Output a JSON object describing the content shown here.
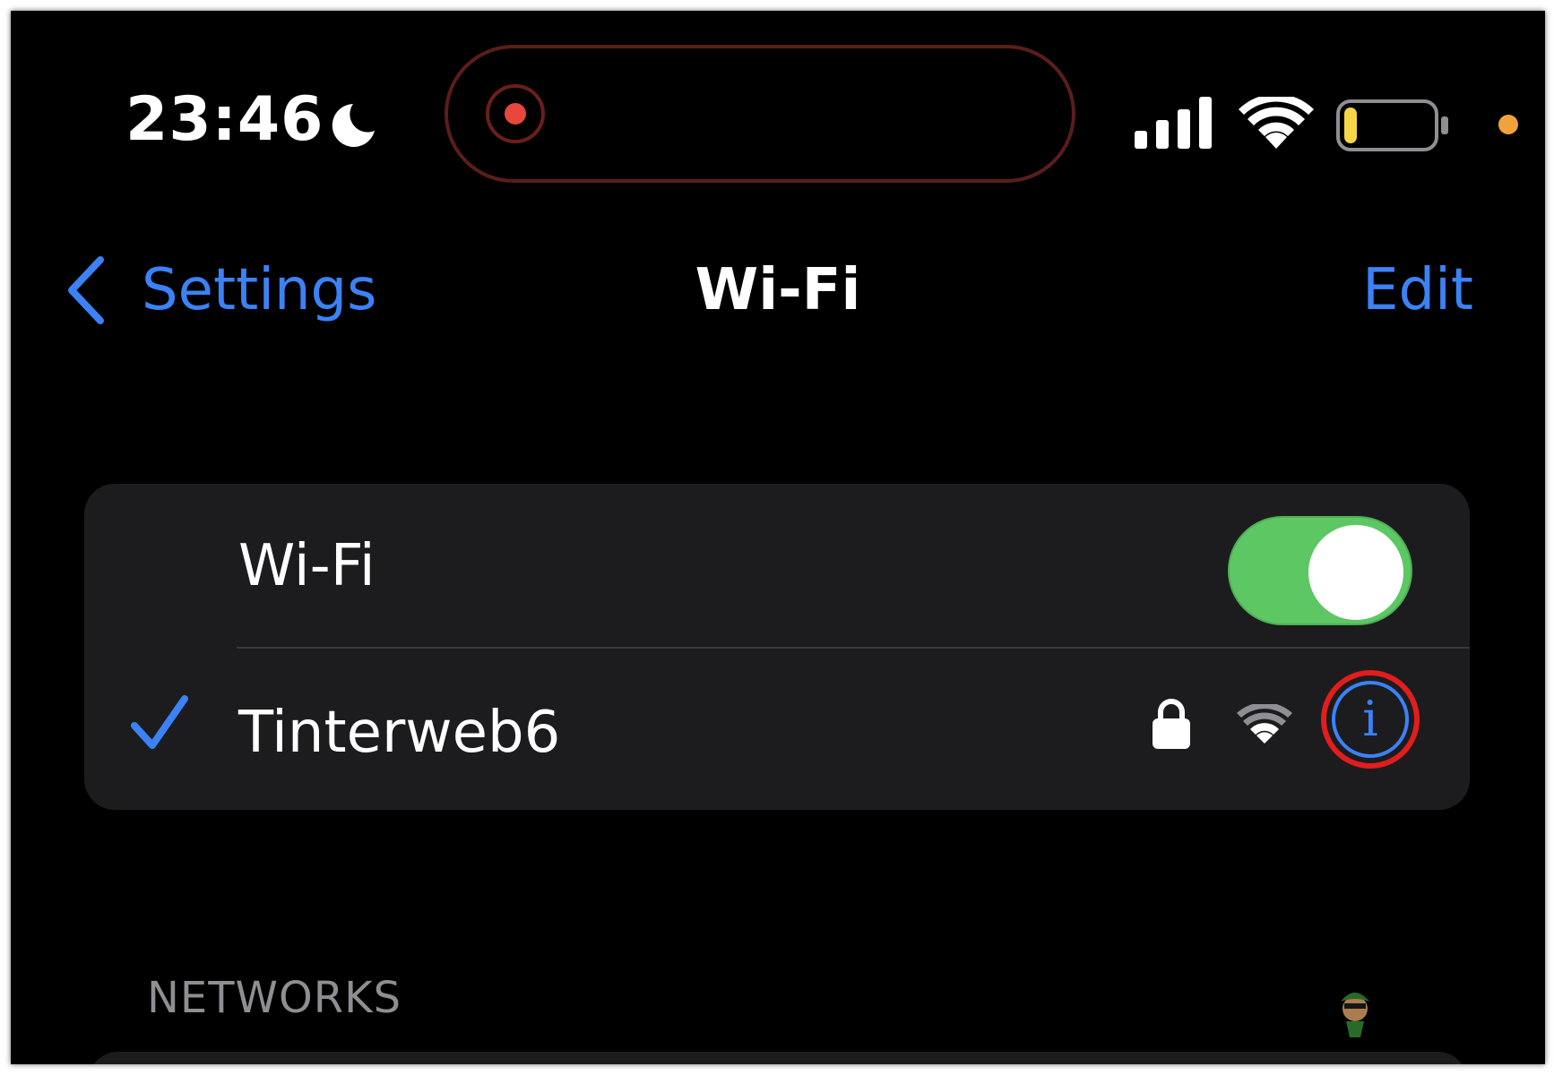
{
  "status_bar": {
    "time": "23:46",
    "focus_icon": "moon-icon",
    "recording_indicator_icon": "record-icon",
    "signal_icon": "cellular-signal-icon",
    "wifi_icon": "wifi-icon",
    "battery_icon": "battery-low-icon",
    "battery_level": 0.15,
    "battery_color": "#f7d547",
    "privacy_dot_color": "#f2a23a"
  },
  "nav": {
    "back_icon": "chevron-left-icon",
    "back_label": "Settings",
    "title": "Wi-Fi",
    "edit_label": "Edit"
  },
  "wifi_card": {
    "wifi_label": "Wi-Fi",
    "wifi_enabled": true,
    "toggle_color": "#5dc763",
    "connected_network": {
      "name": "Tinterweb6",
      "checkmark_icon": "checkmark-icon",
      "lock_icon": "lock-icon",
      "signal_icon": "wifi-icon",
      "info_icon": "info-icon",
      "info_glyph": "i",
      "highlight_color": "#e11d1d"
    }
  },
  "networks_section": {
    "header": "NETWORKS"
  },
  "colors": {
    "accent": "#3b82f6",
    "background": "#000000",
    "card": "#1c1c1e"
  }
}
